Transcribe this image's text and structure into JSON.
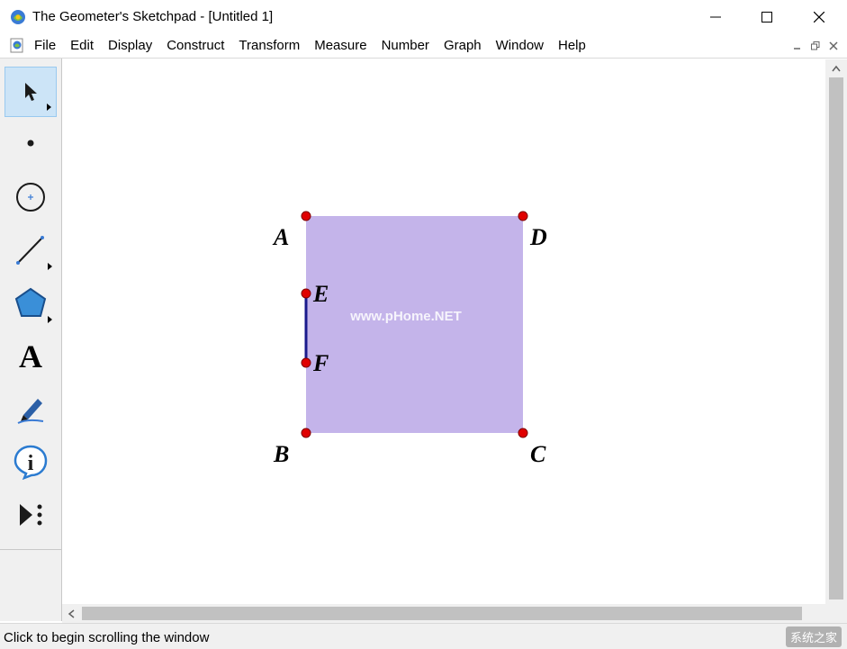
{
  "window": {
    "title": "The Geometer's Sketchpad - [Untitled 1]"
  },
  "menu": {
    "items": [
      "File",
      "Edit",
      "Display",
      "Construct",
      "Transform",
      "Measure",
      "Number",
      "Graph",
      "Window",
      "Help"
    ]
  },
  "toolbox": {
    "tools": [
      {
        "name": "selection-arrow-tool",
        "icon": "arrow-icon",
        "selected": true
      },
      {
        "name": "point-tool",
        "icon": "point-icon"
      },
      {
        "name": "compass-tool",
        "icon": "circle-icon"
      },
      {
        "name": "straightedge-tool",
        "icon": "segment-icon"
      },
      {
        "name": "polygon-tool",
        "icon": "polygon-icon"
      },
      {
        "name": "text-tool",
        "icon": "text-icon",
        "glyph": "A"
      },
      {
        "name": "marker-tool",
        "icon": "marker-icon"
      },
      {
        "name": "information-tool",
        "icon": "info-icon",
        "glyph": "i"
      },
      {
        "name": "custom-tool",
        "icon": "custom-tool-icon"
      }
    ]
  },
  "sketch": {
    "points": {
      "A": "A",
      "B": "B",
      "C": "C",
      "D": "D",
      "E": "E",
      "F": "F"
    },
    "polygon_color": "#c4b4ea",
    "point_color": "#e00000",
    "segment_color": "#1a1a8c",
    "watermark": "www.pHome.NET"
  },
  "statusbar": {
    "text": "Click to begin scrolling the window",
    "corner_watermark": "系统之家"
  }
}
